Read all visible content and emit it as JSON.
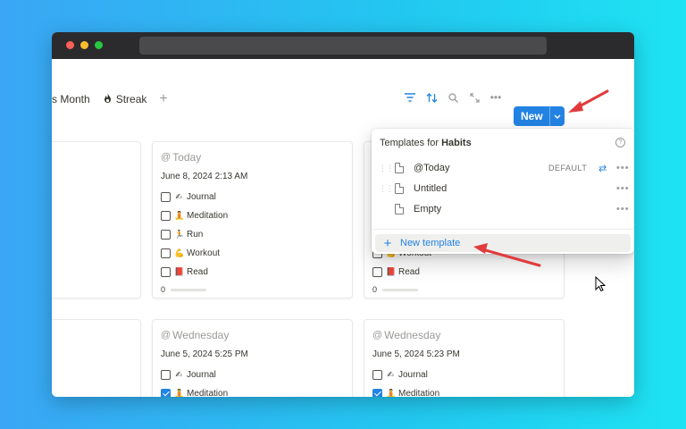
{
  "tabs": [
    {
      "label": "s Month"
    },
    {
      "label": "Streak"
    }
  ],
  "toolbar": {
    "new_label": "New"
  },
  "dropdown": {
    "title_prefix": "Templates for ",
    "title_db": "Habits",
    "help": "?",
    "items": [
      {
        "name": "@Today",
        "badge": "DEFAULT"
      },
      {
        "name": "Untitled"
      },
      {
        "name": "Empty"
      }
    ],
    "new_template": "New template"
  },
  "cards": {
    "today": {
      "title": "Today",
      "date": "June 8, 2024 2:13 AM",
      "habits": [
        {
          "emoji": "✍",
          "label": "Journal",
          "checked": false
        },
        {
          "emoji": "🧘",
          "label": "Meditation",
          "checked": false
        },
        {
          "emoji": "🏃",
          "label": "Run",
          "checked": false
        },
        {
          "emoji": "💪",
          "label": "Workout",
          "checked": false
        },
        {
          "emoji": "📕",
          "label": "Read",
          "checked": false
        }
      ],
      "progress": "0"
    },
    "right_top": {
      "habits": [
        {
          "emoji": "💪",
          "label": "Workout"
        },
        {
          "emoji": "📕",
          "label": "Read"
        }
      ],
      "progress": "0"
    },
    "wednesday1": {
      "title": "Wednesday",
      "date": "June 5, 2024 5:25 PM",
      "habits": [
        {
          "emoji": "✍",
          "label": "Journal",
          "checked": false
        },
        {
          "emoji": "🧘",
          "label": "Meditation",
          "checked": true
        }
      ]
    },
    "wednesday2": {
      "title": "Wednesday",
      "date": "June 5, 2024 5:23 PM",
      "habits": [
        {
          "emoji": "✍",
          "label": "Journal",
          "checked": false
        },
        {
          "emoji": "🧘",
          "label": "Meditation",
          "checked": true
        }
      ]
    }
  },
  "colors": {
    "accent": "#2383e2",
    "annotation": "#e03c3c",
    "titlebar": "#2b2b2e"
  }
}
